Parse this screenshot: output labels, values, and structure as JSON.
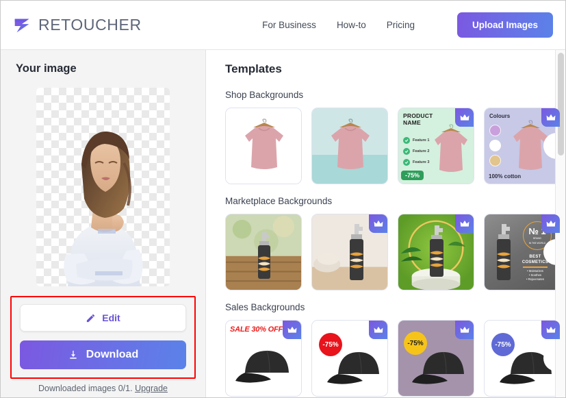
{
  "header": {
    "brand_name": "RETOUCHER",
    "logo_icon": "retoucher-logo-icon",
    "nav": [
      {
        "label": "For Business",
        "name": "nav-for-business"
      },
      {
        "label": "How-to",
        "name": "nav-how-to"
      },
      {
        "label": "Pricing",
        "name": "nav-pricing"
      }
    ],
    "upload_button": "Upload Images"
  },
  "sidebar": {
    "title": "Your image",
    "preview_alt": "cut-out portrait of woman on transparent checkerboard",
    "edit_button": "Edit",
    "edit_icon": "pencil-icon",
    "download_button": "Download",
    "download_icon": "download-arrow-icon",
    "quota_text": "Downloaded images 0/1.",
    "quota_link": "Upgrade",
    "highlight_color": "#fe0000"
  },
  "main": {
    "title": "Templates",
    "accent_gradient_from": "#7b58e0",
    "accent_gradient_to": "#5b82e8",
    "crown_icon": "crown-icon",
    "sections": [
      {
        "label": "Shop Backgrounds",
        "name": "section-shop-backgrounds",
        "cards": [
          {
            "name": "template-shop-1",
            "premium": false,
            "texts": {}
          },
          {
            "name": "template-shop-2",
            "premium": false,
            "texts": {}
          },
          {
            "name": "template-shop-3",
            "premium": true,
            "texts": {
              "product_name_line1": "PRODUCT",
              "product_name_line2": "NAME",
              "feature_1": "Feature 1",
              "feature_2": "Feature 2",
              "feature_3": "Feature 3",
              "discount": "-75%"
            }
          },
          {
            "name": "template-shop-4",
            "premium": true,
            "texts": {
              "colours_title": "Colours",
              "material": "100% cotton",
              "swatch_1": "#c9a0dc",
              "swatch_2": "#ffffff",
              "swatch_3": "#e2c48d"
            }
          }
        ]
      },
      {
        "label": "Marketplace Backgrounds",
        "name": "section-marketplace-backgrounds",
        "cards": [
          {
            "name": "template-marketplace-1",
            "premium": false,
            "texts": {}
          },
          {
            "name": "template-marketplace-2",
            "premium": true,
            "texts": {}
          },
          {
            "name": "template-marketplace-3",
            "premium": true,
            "texts": {}
          },
          {
            "name": "template-marketplace-4",
            "premium": true,
            "texts": {
              "rank": "№ 1",
              "rank_sub_line1": "BRAND",
              "rank_sub_line2": "IN THE WORLD",
              "headline_line1": "BEST",
              "headline_line2": "COSMETICS",
              "bullet_1": "• Moisturizes",
              "bullet_2": "• Soothes",
              "bullet_3": "• Rejuvenates"
            }
          }
        ]
      },
      {
        "label": "Sales Backgrounds",
        "name": "section-sales-backgrounds",
        "cards": [
          {
            "name": "template-sales-1",
            "premium": true,
            "texts": {
              "sale": "SALE 30% OFF"
            }
          },
          {
            "name": "template-sales-2",
            "premium": true,
            "texts": {
              "discount": "-75%",
              "badge_color": "#e8131b",
              "badge_text_color": "#ffffff"
            }
          },
          {
            "name": "template-sales-3",
            "premium": true,
            "texts": {
              "discount": "-75%",
              "badge_color": "#f6c419",
              "badge_text_color": "#1c1c1c"
            }
          },
          {
            "name": "template-sales-4",
            "premium": true,
            "texts": {
              "discount": "-75%",
              "badge_color": "#5f6ad6",
              "badge_text_color": "#ffffff"
            }
          }
        ]
      }
    ]
  }
}
